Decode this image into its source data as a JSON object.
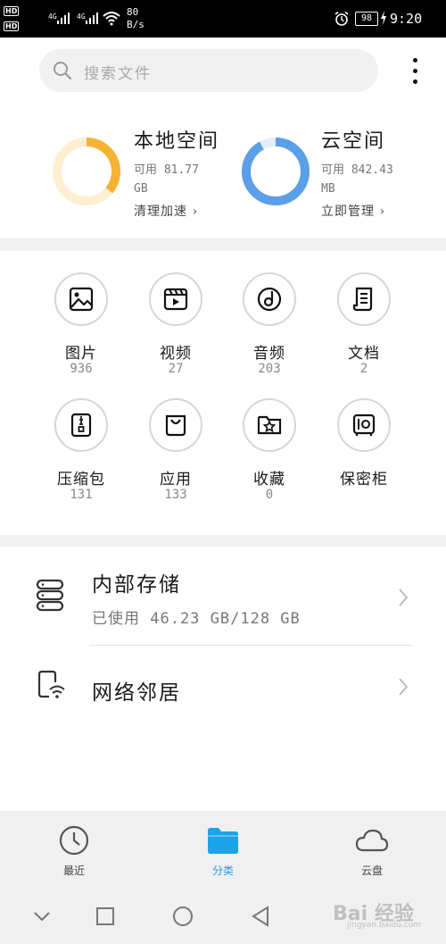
{
  "status_bar": {
    "network": [
      "HD",
      "HD"
    ],
    "signal_labels": [
      "4G",
      "4G"
    ],
    "speed_value": "80",
    "speed_unit": "B/s",
    "battery": "98",
    "time": "9:20"
  },
  "search": {
    "placeholder": "搜索文件"
  },
  "storage_cards": {
    "local": {
      "title": "本地空间",
      "available_line1": "可用 81.77",
      "available_line2": "GB",
      "action": "清理加速 ›",
      "ring_color": "#f5b335",
      "ring_track": "#fdf0d2",
      "used_fraction": 0.36
    },
    "cloud": {
      "title": "云空间",
      "available_line1": "可用 842.43",
      "available_line2": "MB",
      "action": "立即管理 ›",
      "ring_color": "#5a9fe8",
      "ring_track": "#e2eefb",
      "used_fraction": 0.92
    }
  },
  "categories": [
    {
      "label": "图片",
      "count": "936",
      "icon": "image-icon"
    },
    {
      "label": "视频",
      "count": "27",
      "icon": "video-icon"
    },
    {
      "label": "音频",
      "count": "203",
      "icon": "audio-icon"
    },
    {
      "label": "文档",
      "count": "2",
      "icon": "document-icon"
    },
    {
      "label": "压缩包",
      "count": "131",
      "icon": "archive-icon"
    },
    {
      "label": "应用",
      "count": "133",
      "icon": "app-bag-icon"
    },
    {
      "label": "收藏",
      "count": "0",
      "icon": "favorite-folder-icon"
    },
    {
      "label": "保密柜",
      "count": "",
      "icon": "safe-icon"
    }
  ],
  "locations": {
    "internal": {
      "title": "内部存储",
      "subtitle": "已使用 46.23 GB/128 GB",
      "icon": "server-icon"
    },
    "network": {
      "title": "网络邻居",
      "icon": "phone-wifi-icon"
    }
  },
  "bottom_nav": {
    "items": [
      {
        "label": "最近",
        "icon": "clock-icon",
        "active": false
      },
      {
        "label": "分类",
        "icon": "folder-icon",
        "active": true
      },
      {
        "label": "云盘",
        "icon": "cloud-icon",
        "active": false
      }
    ],
    "active_color": "#1aa3e6"
  },
  "system_nav": [
    "chevron-down-icon",
    "recents-square-icon",
    "home-circle-icon",
    "back-triangle-icon"
  ],
  "watermark": {
    "text": "Bai 经验",
    "sub": "jingyan.baidu.com"
  }
}
